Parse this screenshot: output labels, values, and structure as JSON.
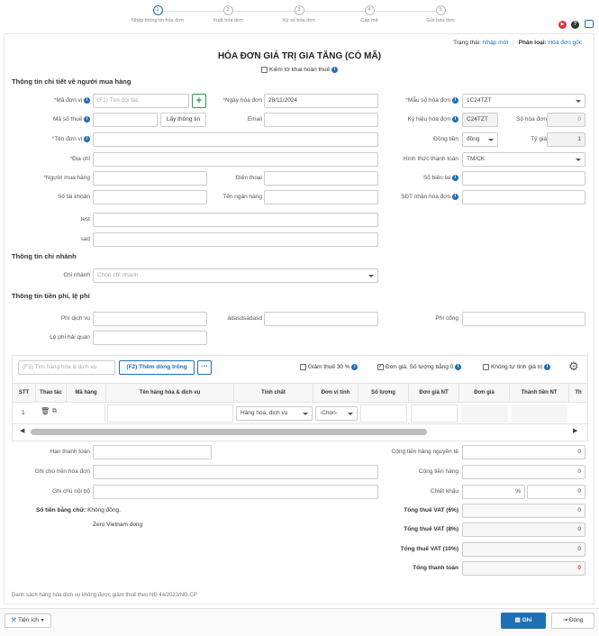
{
  "steps": [
    {
      "n": "1",
      "label": "Nhập thông tin hóa đơn"
    },
    {
      "n": "2",
      "label": "Xuất hóa đơn"
    },
    {
      "n": "3",
      "label": "Ký số hóa đơn"
    },
    {
      "n": "4",
      "label": "Cấp mã"
    },
    {
      "n": "5",
      "label": "Gửi hóa đơn"
    }
  ],
  "status": {
    "label": "Trạng thái:",
    "value": "Nhập mới",
    "category_label": "Phân loại:",
    "category_value": "Hóa đơn gốc"
  },
  "title": "HÓA ĐƠN GIÁ TRỊ GIA TĂNG (CÓ MÃ)",
  "tax_check_label": "Kiêm tờ khai hoàn thuế",
  "buyer": {
    "section": "Thông tin chi tiết về người mua hàng",
    "unit_code_label": "Mã đơn vị",
    "unit_code_placeholder": "(F1) Tìm đối tác",
    "tax_code_label": "Mã số thuế",
    "lookup_button": "Lấy thông tin",
    "unit_name_label": "Tên đơn vị",
    "address_label": "Địa chỉ",
    "buyer_label": "Người mua hàng",
    "account_label": "Số tài khoản",
    "test_label": "test",
    "sad_label": "sad",
    "date_label": "Ngày hóa đơn",
    "date_value": "28/11/2024",
    "email_label": "Email",
    "phone_label": "Điện thoại",
    "bank_label": "Tên ngân hàng",
    "template_label": "Mẫu số hóa đơn",
    "template_value": "1C24TZT",
    "symbol_label": "Ký hiệu hóa đơn",
    "symbol_value": "C24TZT",
    "number_label": "Số hóa đơn",
    "number_value": "0",
    "currency_label": "Đồng tiền",
    "currency_value": "đồng",
    "rate_label": "Tỷ giá",
    "rate_value": "1",
    "payment_label": "Hình thức thanh toán",
    "payment_value": "TM/CK",
    "receipt_label": "Số biên lai",
    "recv_phone_label": "SĐT nhận hóa đơn"
  },
  "branch": {
    "section": "Thông tin chi nhánh",
    "label": "Chi nhánh",
    "placeholder": "Chọn chi nhánh"
  },
  "fees": {
    "section": "Thông tin tiền phí, lệ phí",
    "service_label": "Phí dịch vụ",
    "custom_label": "ádasdsadasd",
    "gate_label": "Phí cổng",
    "customs_label": "Lệ phí hải quan"
  },
  "toolbar": {
    "search_placeholder": "(F3) Tìm hàng hóa & dịch vụ",
    "add_rows": "(F2) Thêm dòng trống",
    "reduce_tax": "Giảm thuế 30 %",
    "unit_price_qty": "Đơn giá, Số lượng bằng 0",
    "no_auto_calc": "Không tự tính giá trị"
  },
  "table": {
    "headers": [
      "STT",
      "Thao tác",
      "Mã hàng",
      "Tên hàng hóa & dịch vụ",
      "Tính chất",
      "Đơn vị tính",
      "Số lượng",
      "Đơn giá NT",
      "Đơn giá",
      "Thành tiền NT",
      "Th"
    ],
    "row": {
      "stt": "1",
      "nature": "Hàng hóa, dịch vụ",
      "unit": "-Chọn-"
    }
  },
  "footer": {
    "deadline_label": "Hạn thanh toán",
    "note_label": "Ghi chú trên hóa đơn",
    "internal_label": "Ghi chú nội bộ",
    "words_label": "Số tiền bằng chữ:",
    "words_value": "Không đồng.",
    "words_en": "Zero Vietnam dong",
    "subtotal_label": "Cộng tiền hàng nguyên tệ",
    "subtotal_value": "0",
    "goods_label": "Cộng tiền hàng",
    "goods_value": "0",
    "discount_label": "Chiết khấu",
    "discount_pct": "%",
    "discount_value": "0",
    "vat6_label": "Tổng thuế VAT (6%)",
    "vat6_value": "0",
    "vat8_label": "Tổng thuế VAT (8%)",
    "vat8_value": "0",
    "vat10_label": "Tổng thuế VAT (10%)",
    "vat10_value": "0",
    "total_label": "Tổng thanh toán",
    "total_value": "0",
    "list_note": "Danh sách hàng hóa dịch vụ không được giảm thuế theo NĐ 44/2023/NĐ-CP"
  },
  "bottom": {
    "utility": "Tiện ích",
    "save": "Ghi",
    "close": "Đóng"
  },
  "colors": {
    "primary": "#1f6fb5",
    "green": "#2a9d4b",
    "red": "#e33"
  }
}
